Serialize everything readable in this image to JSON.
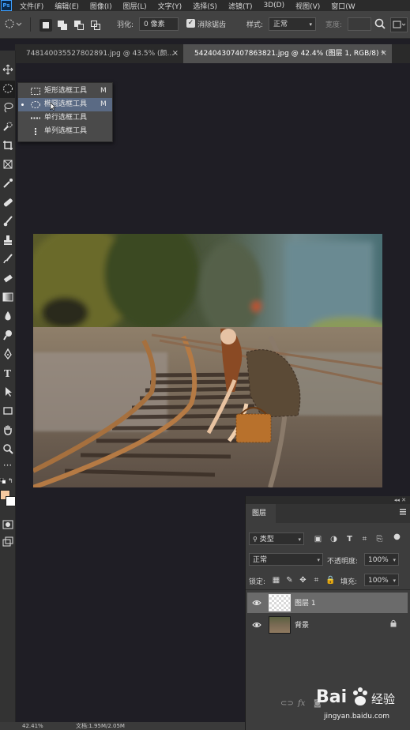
{
  "menu": {
    "items": [
      "文件(F)",
      "编辑(E)",
      "图像(I)",
      "图层(L)",
      "文字(Y)",
      "选择(S)",
      "滤镜(T)",
      "3D(D)",
      "视图(V)",
      "窗口(W"
    ]
  },
  "options": {
    "feather_label": "羽化:",
    "feather_value": "0 像素",
    "antialias_label": "消除锯齿",
    "antialias_checked": true,
    "style_label": "样式:",
    "style_value": "正常",
    "width_label": "宽度:"
  },
  "tabs": [
    {
      "label": "748140035527802891.jpg @ 43.5% (颜...",
      "active": false
    },
    {
      "label": "542404307407863821.jpg @ 42.4% (图层 1, RGB/8) *",
      "active": true
    }
  ],
  "flyout": {
    "items": [
      {
        "icon": "rectangular-marquee-icon",
        "label": "矩形选框工具",
        "key": "M",
        "selected": false
      },
      {
        "icon": "elliptical-marquee-icon",
        "label": "椭圆选框工具",
        "key": "M",
        "selected": true
      },
      {
        "icon": "single-row-marquee-icon",
        "label": "单行选框工具",
        "key": "",
        "selected": false
      },
      {
        "icon": "single-column-marquee-icon",
        "label": "单列选框工具",
        "key": "",
        "selected": false
      }
    ]
  },
  "tools": [
    "move-icon",
    "elliptical-marquee-icon",
    "lasso-icon",
    "quick-select-icon",
    "crop-icon",
    "frame-icon",
    "eyedropper-icon",
    "healing-brush-icon",
    "brush-icon",
    "clone-stamp-icon",
    "history-brush-icon",
    "eraser-icon",
    "gradient-icon",
    "blur-icon",
    "dodge-icon",
    "pen-icon",
    "type-icon",
    "path-select-icon",
    "rectangle-icon",
    "hand-icon",
    "zoom-icon",
    "more-icon"
  ],
  "colors": {
    "foreground": "#f5c9a0",
    "background": "#ffffff",
    "accent": "#5a6a84"
  },
  "layers_panel": {
    "title": "图层",
    "filter_value": "类型",
    "blend_mode": "正常",
    "opacity_label": "不透明度:",
    "opacity_value": "100%",
    "lock_label": "锁定:",
    "fill_label": "填充:",
    "fill_value": "100%",
    "layers": [
      {
        "name": "图层 1",
        "selected": true,
        "visible": true,
        "locked": false,
        "thumb": "transparent"
      },
      {
        "name": "背景",
        "selected": false,
        "visible": true,
        "locked": true,
        "thumb": "photo"
      }
    ]
  },
  "status": {
    "zoom": "42.41%",
    "doc": "文档:1.95M/2.05M"
  },
  "watermark": {
    "brand": "Bai",
    "brand2": "经验",
    "url": "jingyan.baidu.com"
  }
}
